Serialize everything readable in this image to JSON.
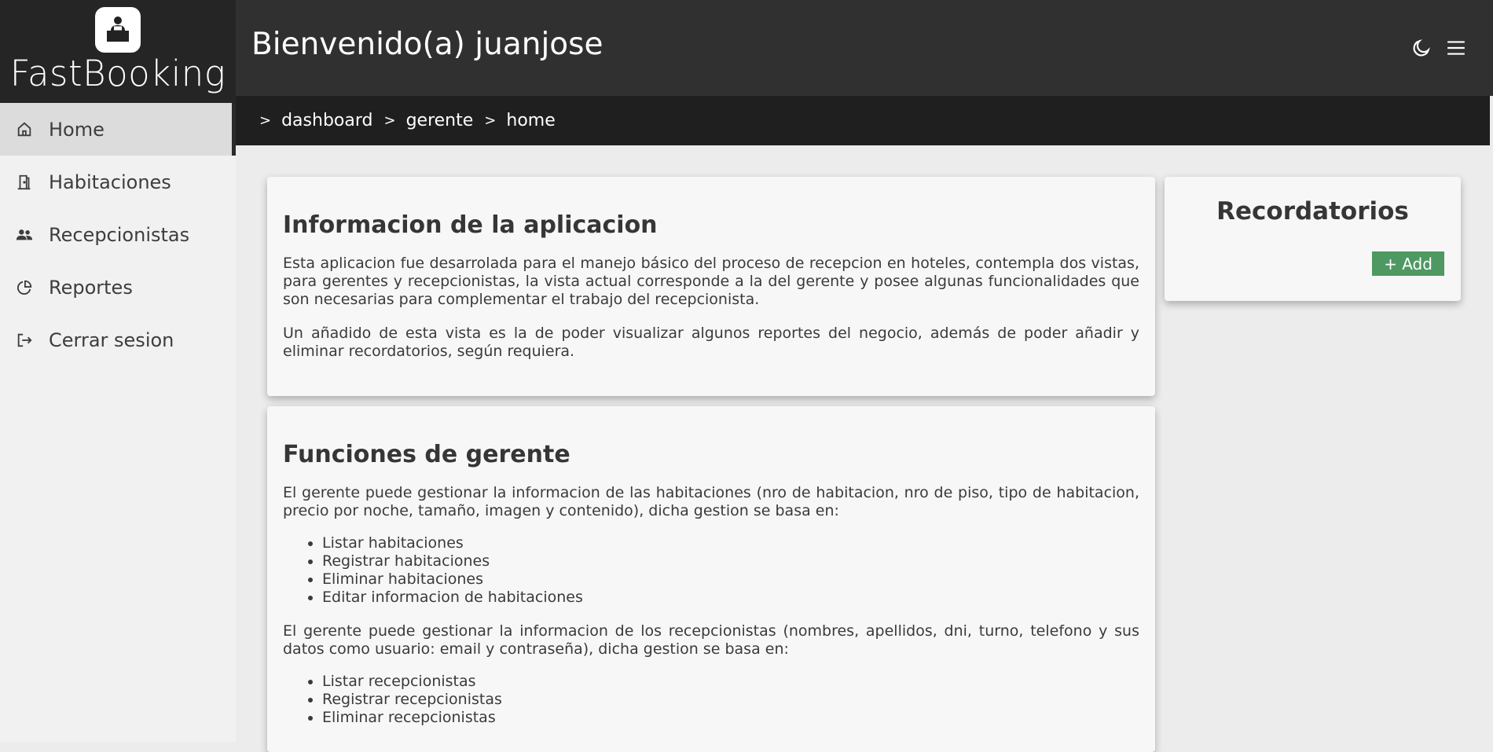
{
  "brand": {
    "name": "FastBooking",
    "logo_icon": "receptionist-desk-icon"
  },
  "sidebar": {
    "items": [
      {
        "label": "Home",
        "icon": "home-icon",
        "active": true
      },
      {
        "label": "Habitaciones",
        "icon": "door-icon",
        "active": false
      },
      {
        "label": "Recepcionistas",
        "icon": "users-icon",
        "active": false
      },
      {
        "label": "Reportes",
        "icon": "pie-chart-icon",
        "active": false
      },
      {
        "label": "Cerrar sesion",
        "icon": "logout-icon",
        "active": false
      }
    ]
  },
  "header": {
    "title": "Bienvenido(a) juanjose",
    "theme_icon": "moon-icon",
    "menu_icon": "hamburger-menu-icon"
  },
  "breadcrumb": {
    "items": [
      "dashboard",
      "gerente",
      "home"
    ]
  },
  "info_card": {
    "title": "Informacion de la aplicacion",
    "p1": "Esta aplicacion fue desarrolada para el manejo básico del proceso de recepcion en hoteles, contempla dos vistas, para gerentes y recepcionistas, la vista actual corresponde a la del gerente y posee algunas funcionalidades que son necesarias para complementar el trabajo del recepcionista.",
    "p2": "Un añadido de esta vista es la de poder visualizar algunos reportes del negocio, además de poder añadir y eliminar recordatorios, según requiera."
  },
  "functions_card": {
    "title": "Funciones de gerente",
    "p1": "El gerente puede gestionar la informacion de las habitaciones (nro de habitacion, nro de piso, tipo de habitacion, precio por noche, tamaño, imagen y contenido), dicha gestion se basa en:",
    "list1": [
      "Listar habitaciones",
      "Registrar habitaciones",
      "Eliminar habitaciones",
      "Editar informacion de habitaciones"
    ],
    "p2": "El gerente puede gestionar la informacion de los recepcionistas (nombres, apellidos, dni, turno, telefono y sus datos como usuario: email y contraseña), dicha gestion se basa en:",
    "list2": [
      "Listar recepcionistas",
      "Registrar recepcionistas",
      "Eliminar recepcionistas"
    ]
  },
  "reminders": {
    "title": "Recordatorios",
    "add_label": "+ Add"
  },
  "colors": {
    "header_bg": "#303030",
    "breadcrumb_bg": "#1f1f1f",
    "sidebar_bg": "#f1f1f1",
    "sidebar_active_bg": "#dcdcdc",
    "add_button": "#4e9862",
    "page_bg": "#ececec",
    "card_bg": "#f7f7f7"
  }
}
